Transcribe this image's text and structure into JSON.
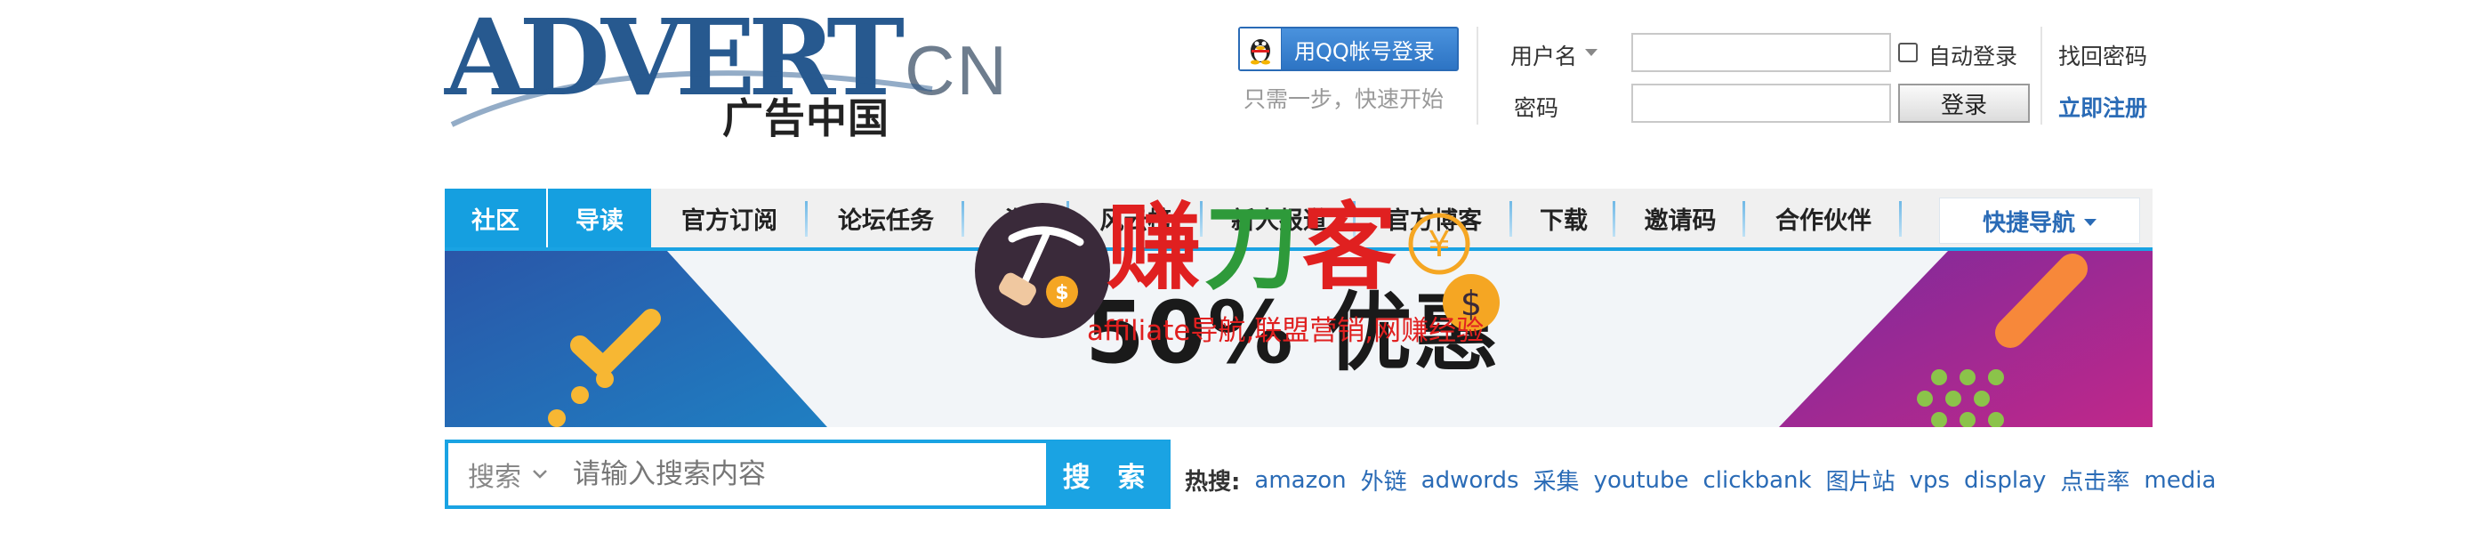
{
  "logo": {
    "word": "ADVERT",
    "suffix": "CN",
    "subtitle": "广告中国"
  },
  "login": {
    "qq_button": "用QQ帐号登录",
    "qq_tip": "只需一步，快速开始",
    "username_label": "用户名",
    "password_label": "密码",
    "username_value": "",
    "password_value": "",
    "auto_login": "自动登录",
    "auto_login_checked": false,
    "login_button": "登录",
    "forgot_password": "找回密码",
    "register": "立即注册"
  },
  "nav": {
    "items": [
      {
        "label": "社区",
        "active": true
      },
      {
        "label": "导读",
        "active": true
      },
      {
        "label": "官方订阅",
        "active": false
      },
      {
        "label": "论坛任务",
        "active": false
      },
      {
        "label": "淘",
        "active": false
      },
      {
        "label": "风云榜",
        "active": false
      },
      {
        "label": "新人报道",
        "active": false
      },
      {
        "label": "官方博客",
        "active": false
      },
      {
        "label": "下载",
        "active": false
      },
      {
        "label": "邀请码",
        "active": false
      },
      {
        "label": "合作伙伴",
        "active": false
      }
    ],
    "quick_nav": "快捷导航"
  },
  "banner": {
    "text": "50% 优惠"
  },
  "watermark": {
    "title_part1": "赚",
    "title_part2": "刀",
    "title_part3": "客",
    "subtitle": "affiliate导航,联盟营销,网赚经验"
  },
  "search": {
    "scope": "搜索",
    "placeholder": "请输入搜索内容",
    "value": "",
    "button": "搜 索"
  },
  "hot_search": {
    "label": "热搜:",
    "terms": [
      "amazon",
      "外链",
      "adwords",
      "采集",
      "youtube",
      "clickbank",
      "图片站",
      "vps",
      "display",
      "点击率",
      "media"
    ]
  },
  "colors": {
    "accent": "#1aa3e3",
    "brand_blue": "#27598f",
    "link": "#2a6bb6",
    "watermark_red": "#e02020"
  }
}
